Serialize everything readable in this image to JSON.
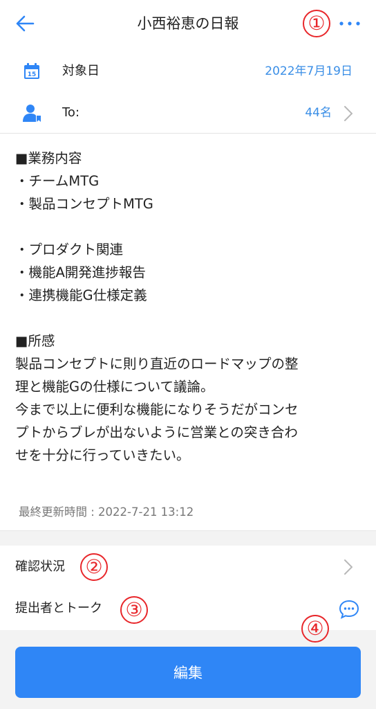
{
  "header": {
    "title": "小西裕恵の日報",
    "annotation": "①"
  },
  "target_date": {
    "label": "対象日",
    "value": "2022年7月19日"
  },
  "recipients": {
    "label": "To:",
    "value": "44名"
  },
  "body": {
    "lines": [
      "■業務内容",
      "・チームMTG",
      "・製品コンセプトMTG",
      "",
      "・プロダクト関連",
      "・機能A開発進捗報告",
      "・連携機能G仕様定義",
      "",
      "■所感",
      "製品コンセプトに則り直近のロードマップの整",
      "理と機能Gの仕様について議論。",
      "今まで以上に便利な機能になりそうだがコンセ",
      "プトからブレが出ないように営業との突き合わ",
      "せを十分に行っていきたい。"
    ]
  },
  "updated": "最終更新時間 : 2022-7-21 13:12",
  "confirmation": {
    "label": "確認状況",
    "annotation": "②"
  },
  "talk": {
    "label": "提出者とトーク",
    "annotation": "③",
    "icon_annotation": "④"
  },
  "footer": {
    "edit_label": "編集"
  },
  "colors": {
    "accent": "#2f86f6",
    "link": "#3a8ee6",
    "annotation": "#e8262a"
  }
}
